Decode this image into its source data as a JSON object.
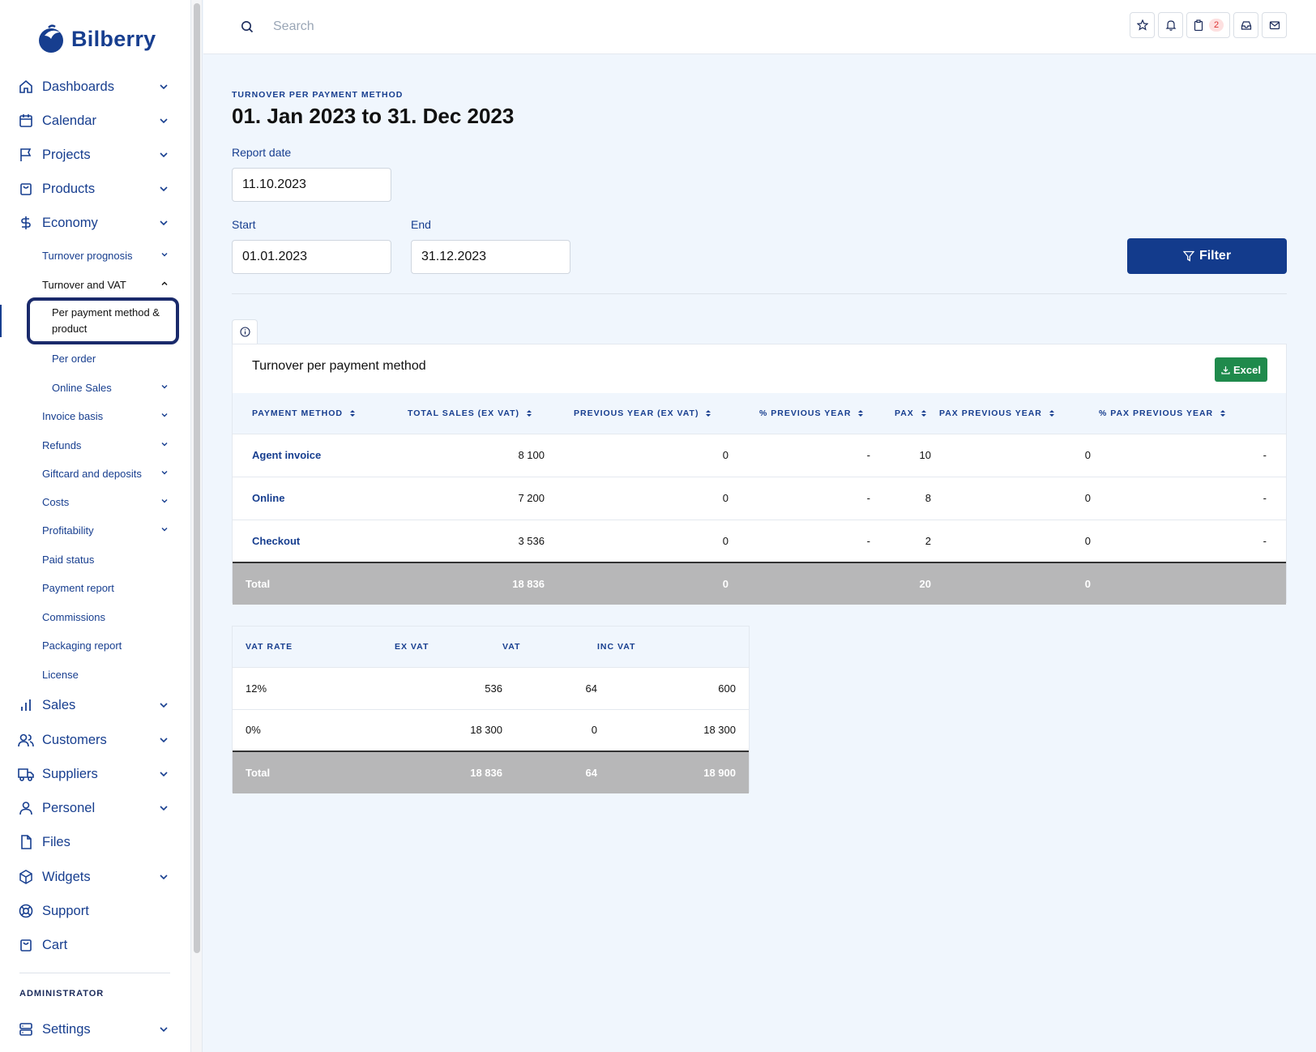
{
  "brand": {
    "name": "Bilberry",
    "color": "#173e8f"
  },
  "nav": {
    "dashboards": "Dashboards",
    "calendar": "Calendar",
    "projects": "Projects",
    "products": "Products",
    "economy": "Economy",
    "economy_items": {
      "turnover_prognosis": "Turnover prognosis",
      "turnover_and_vat": "Turnover and VAT",
      "per_payment_method_product": "Per payment method & product",
      "per_order": "Per order",
      "online_sales": "Online Sales",
      "invoice_basis": "Invoice basis",
      "refunds": "Refunds",
      "giftcard_deposits": "Giftcard and deposits",
      "costs": "Costs",
      "profitability": "Profitability",
      "paid_status": "Paid status",
      "payment_report": "Payment report",
      "commissions": "Commissions",
      "packaging_report": "Packaging report",
      "license": "License"
    },
    "sales": "Sales",
    "customers": "Customers",
    "suppliers": "Suppliers",
    "personel": "Personel",
    "files": "Files",
    "widgets": "Widgets",
    "support": "Support",
    "cart": "Cart",
    "admin_label": "ADMINISTRATOR",
    "settings": "Settings"
  },
  "topbar": {
    "search_placeholder": "Search",
    "clipboard_badge": "2"
  },
  "page": {
    "eyebrow": "TURNOVER PER PAYMENT METHOD",
    "title": "01. Jan 2023 to 31. Dec 2023",
    "report_date_label": "Report date",
    "report_date_value": "11.10.2023",
    "start_label": "Start",
    "start_value": "01.01.2023",
    "end_label": "End",
    "end_value": "31.12.2023",
    "filter_label": "Filter"
  },
  "turnover_table": {
    "title": "Turnover per payment method",
    "excel_label": "Excel",
    "headers": [
      "PAYMENT METHOD",
      "TOTAL SALES (EX VAT)",
      "PREVIOUS YEAR (EX VAT)",
      "% PREVIOUS YEAR",
      "PAX",
      "PAX PREVIOUS YEAR",
      "% PAX PREVIOUS YEAR"
    ],
    "rows": [
      [
        "Agent invoice",
        "8 100",
        "0",
        "-",
        "10",
        "0",
        "-"
      ],
      [
        "Online",
        "7 200",
        "0",
        "-",
        "8",
        "0",
        "-"
      ],
      [
        "Checkout",
        "3 536",
        "0",
        "-",
        "2",
        "0",
        "-"
      ]
    ],
    "total": [
      "Total",
      "18 836",
      "0",
      "",
      "20",
      "0",
      ""
    ]
  },
  "vat_table": {
    "headers": [
      "VAT RATE",
      "EX VAT",
      "VAT",
      "INC VAT"
    ],
    "rows": [
      [
        "12%",
        "536",
        "64",
        "600"
      ],
      [
        "0%",
        "18 300",
        "0",
        "18 300"
      ]
    ],
    "total": [
      "Total",
      "18 836",
      "64",
      "18 900"
    ]
  }
}
